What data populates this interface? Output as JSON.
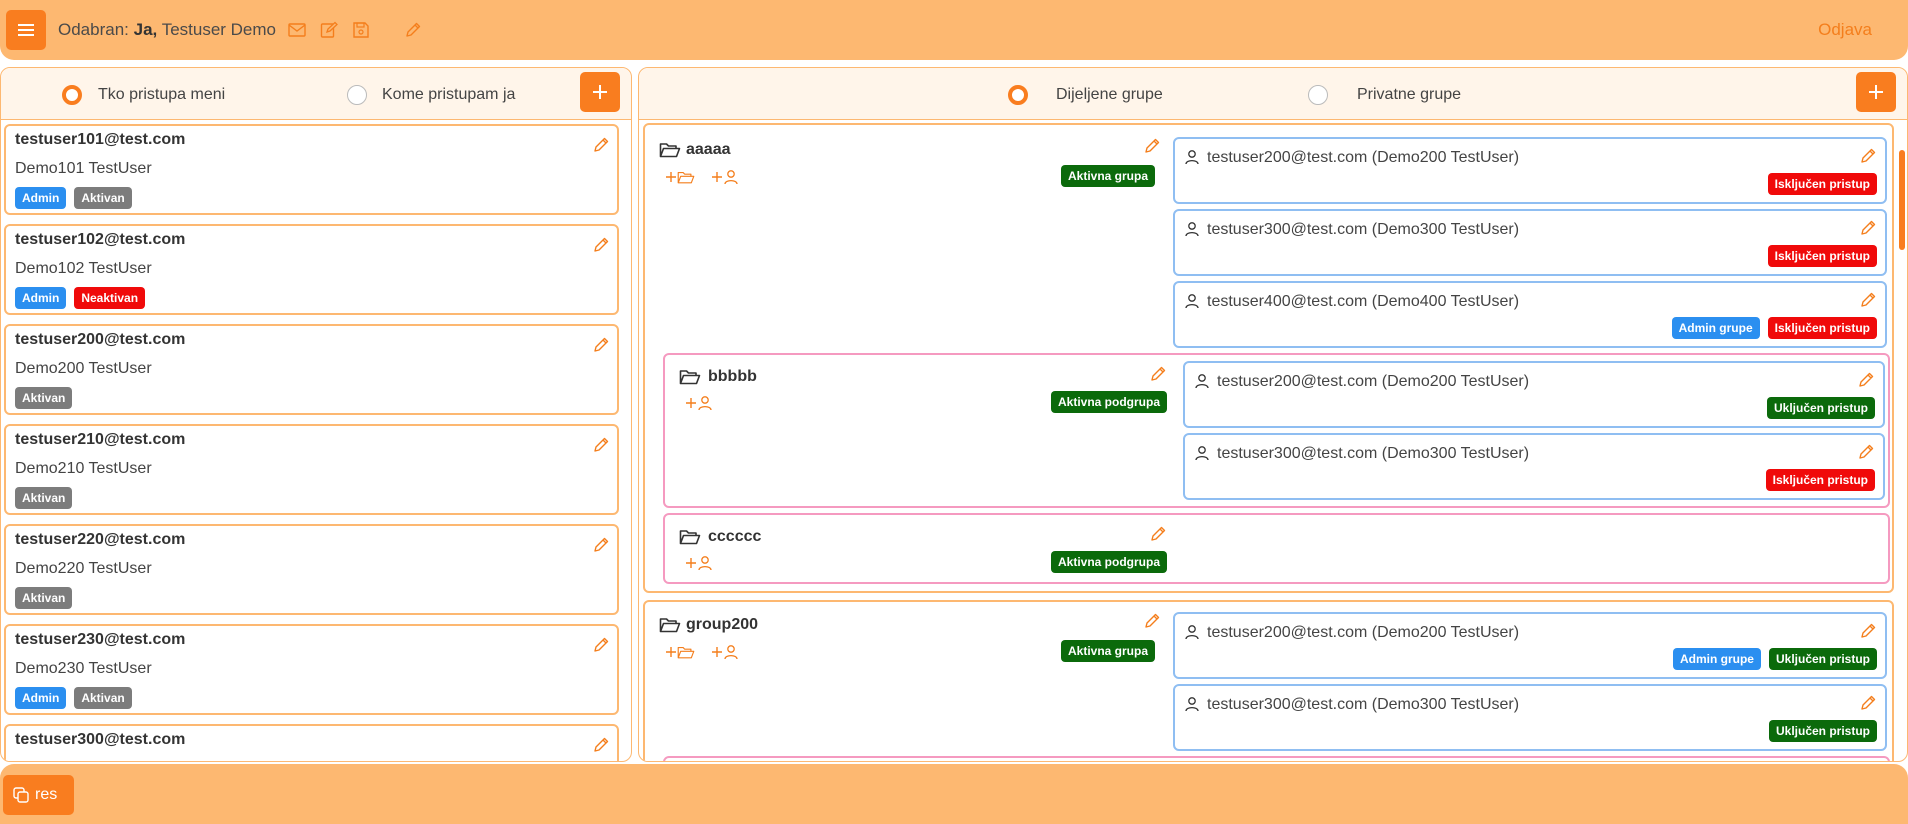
{
  "topbar": {
    "selected_label": "Odabran:",
    "selected_user_bold": "Ja,",
    "selected_user": "Testuser Demo",
    "logout": "Odjava"
  },
  "left": {
    "radio_who": "Tko pristupa meni",
    "radio_whom": "Kome pristupam ja",
    "users": [
      {
        "email": "testuser101@test.com",
        "name": "Demo101 TestUser",
        "badges": [
          {
            "t": "Admin",
            "c": "admin"
          },
          {
            "t": "Aktivan",
            "c": "grey"
          }
        ]
      },
      {
        "email": "testuser102@test.com",
        "name": "Demo102 TestUser",
        "badges": [
          {
            "t": "Admin",
            "c": "admin"
          },
          {
            "t": "Neaktivan",
            "c": "red"
          }
        ]
      },
      {
        "email": "testuser200@test.com",
        "name": "Demo200 TestUser",
        "badges": [
          {
            "t": "Aktivan",
            "c": "grey"
          }
        ]
      },
      {
        "email": "testuser210@test.com",
        "name": "Demo210 TestUser",
        "badges": [
          {
            "t": "Aktivan",
            "c": "grey"
          }
        ]
      },
      {
        "email": "testuser220@test.com",
        "name": "Demo220 TestUser",
        "badges": [
          {
            "t": "Aktivan",
            "c": "grey"
          }
        ]
      },
      {
        "email": "testuser230@test.com",
        "name": "Demo230 TestUser",
        "badges": [
          {
            "t": "Admin",
            "c": "admin"
          },
          {
            "t": "Aktivan",
            "c": "grey"
          }
        ]
      },
      {
        "email": "testuser300@test.com",
        "name": "",
        "badges": []
      }
    ]
  },
  "right": {
    "radio_shared": "Dijeljene grupe",
    "radio_private": "Privatne grupe",
    "groups": {
      "g1": {
        "name": "aaaaa",
        "status": "Aktivna grupa"
      },
      "g1s1": {
        "name": "bbbbb",
        "status": "Aktivna podgrupa"
      },
      "g1s2": {
        "name": "cccccc",
        "status": "Aktivna podgrupa"
      },
      "g2": {
        "name": "group200",
        "status": "Aktivna grupa"
      }
    },
    "members": {
      "g1m1": "testuser200@test.com (Demo200 TestUser)",
      "g1m2": "testuser300@test.com (Demo300 TestUser)",
      "g1m3": "testuser400@test.com (Demo400 TestUser)",
      "s1m1": "testuser200@test.com (Demo200 TestUser)",
      "s1m2": "testuser300@test.com (Demo300 TestUser)",
      "g2m1": "testuser200@test.com (Demo200 TestUser)",
      "g2m2": "testuser300@test.com (Demo300 TestUser)"
    },
    "badges": {
      "excluded": "Isključen pristup",
      "included": "Uključen pristup",
      "group_admin": "Admin grupe"
    }
  },
  "bottombar": {
    "res_label": "res"
  },
  "colors": {
    "accent": "#f97d1f",
    "bar": "#fdb871",
    "admin": "#2b8ff0",
    "red": "#f00a0a",
    "green": "#0b6a0b",
    "grey": "#7c7c7c"
  }
}
